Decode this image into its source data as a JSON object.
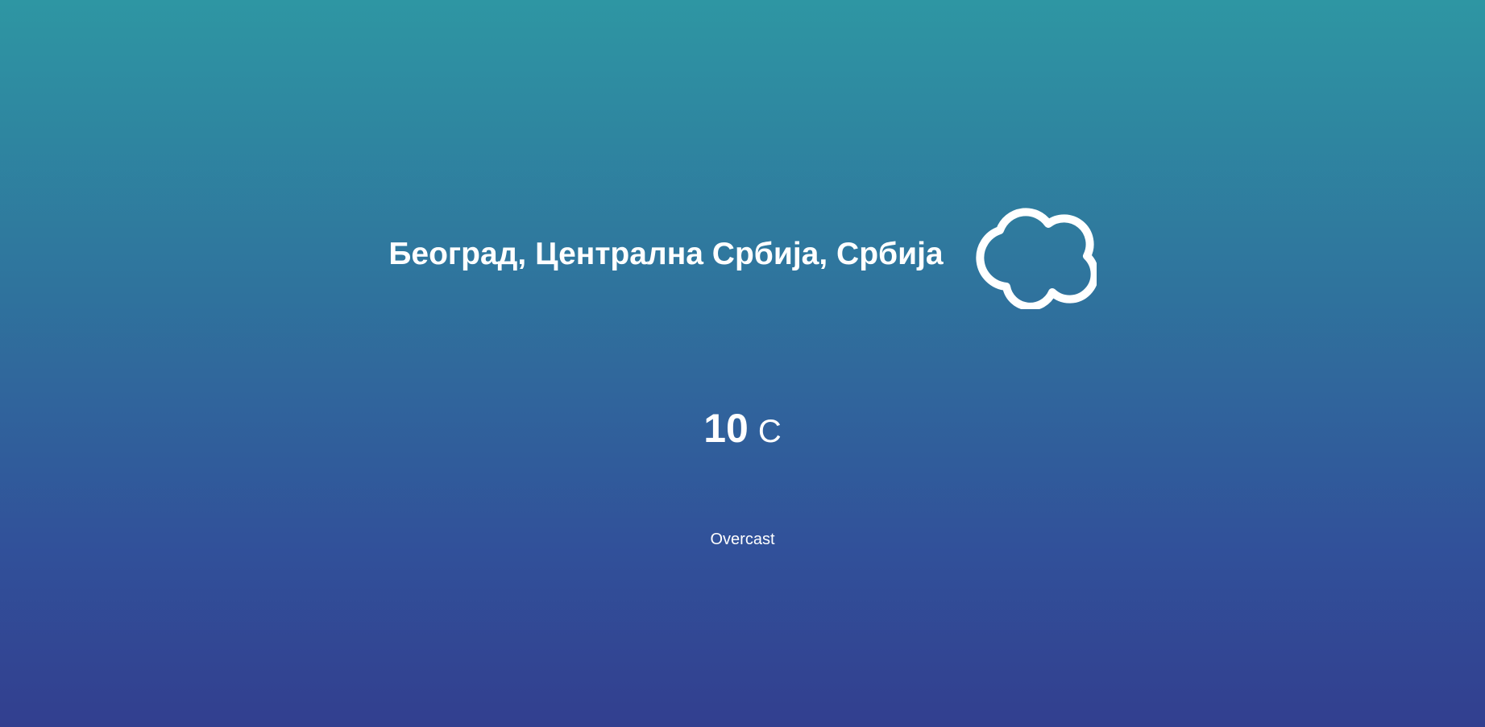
{
  "location": {
    "name": "Београд, Централна Србија, Србија"
  },
  "weather": {
    "icon": "cloud-icon",
    "temperature": "10",
    "unit": "C",
    "condition": "Overcast"
  },
  "colors": {
    "gradient_top": "#2e96a3",
    "gradient_bottom": "#323f8f",
    "text": "#ffffff"
  }
}
